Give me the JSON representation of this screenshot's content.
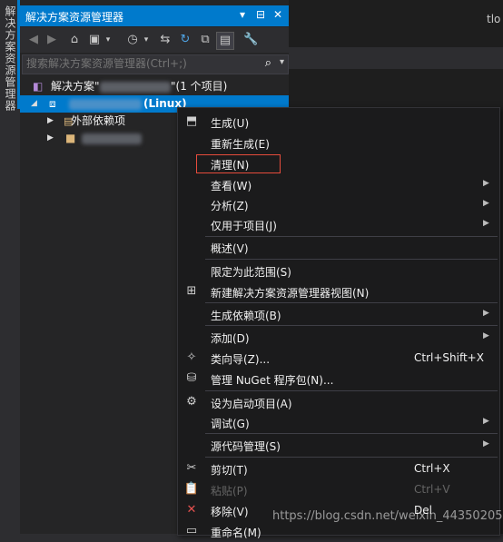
{
  "side_tab": {
    "label": "解决方案资源管理器"
  },
  "solution_explorer": {
    "title": "解决方案资源管理器",
    "title_controls": [
      "▾",
      "⊟",
      "✕"
    ],
    "search": {
      "placeholder": "搜索解决方案资源管理器(Ctrl+;)"
    },
    "tree": {
      "solution": {
        "prefix": "解决方案\"",
        "suffix": "\"(1 个项目)"
      },
      "project": {
        "suffix": "(Linux)"
      },
      "external_deps": "外部依赖项"
    }
  },
  "editor": {
    "tab_partial": "tlo"
  },
  "context_menu": {
    "items": [
      {
        "label": "生成(U)",
        "icon": "build-icon"
      },
      {
        "label": "重新生成(E)"
      },
      {
        "label": "清理(N)"
      },
      {
        "label": "查看(W)",
        "submenu": true
      },
      {
        "label": "分析(Z)",
        "submenu": true
      },
      {
        "label": "仅用于项目(J)",
        "submenu": true
      },
      {
        "label": "概述(V)"
      },
      {
        "label": "限定为此范围(S)"
      },
      {
        "label": "新建解决方案资源管理器视图(N)",
        "icon": "new-view-icon"
      },
      {
        "label": "生成依赖项(B)",
        "submenu": true
      },
      {
        "label": "添加(D)",
        "submenu": true
      },
      {
        "label": "类向导(Z)...",
        "shortcut": "Ctrl+Shift+X",
        "icon": "class-wizard-icon"
      },
      {
        "label": "管理 NuGet 程序包(N)...",
        "icon": "nuget-icon"
      },
      {
        "label": "设为启动项目(A)",
        "icon": "gear-icon"
      },
      {
        "label": "调试(G)",
        "submenu": true
      },
      {
        "label": "源代码管理(S)",
        "submenu": true
      },
      {
        "label": "剪切(T)",
        "shortcut": "Ctrl+X",
        "icon": "cut-icon"
      },
      {
        "label": "粘贴(P)",
        "shortcut": "Ctrl+V",
        "disabled": true,
        "icon": "paste-icon"
      },
      {
        "label": "移除(V)",
        "shortcut": "Del",
        "icon": "remove-icon"
      },
      {
        "label": "重命名(M)",
        "icon": "rename-icon"
      }
    ]
  },
  "watermark": "https://blog.csdn.net/weixin_44350205",
  "colors": {
    "accent": "#007acc",
    "highlight_box": "#e74c3c",
    "menu_bg": "#1b1b1c"
  }
}
